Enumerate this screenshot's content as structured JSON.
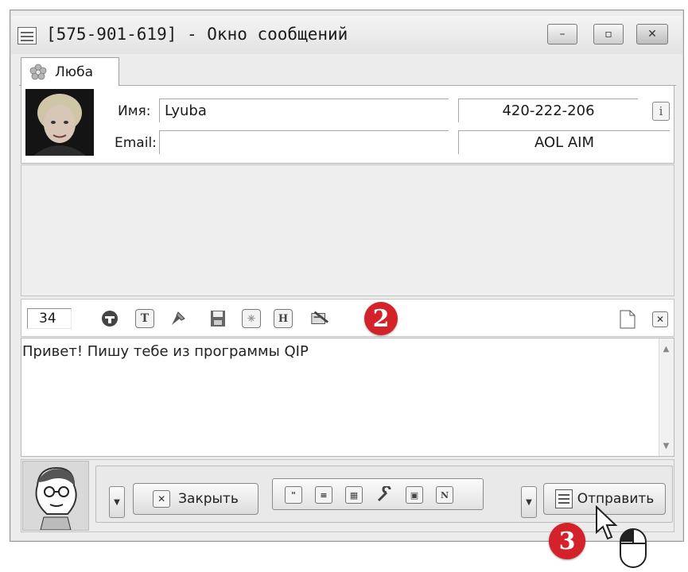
{
  "window": {
    "title": "[575-901-619] - Окно сообщений",
    "min_glyph": "–",
    "max_glyph": "▫",
    "close_glyph": "✕"
  },
  "tab": {
    "label": "Люба",
    "icon": "flower-status-icon"
  },
  "contact": {
    "name_label": "Имя:",
    "name_value": "Lyuba",
    "email_label": "Email:",
    "email_value": "",
    "uin": "420-222-206",
    "protocol": "AOL AIM",
    "info_icon": "info-icon"
  },
  "toolbar": {
    "char_count": "34",
    "icons": [
      "smiley-icon",
      "font-icon",
      "color-icon",
      "save-icon",
      "insert-icon",
      "history-icon",
      "clear-icon"
    ],
    "marker_2": "2"
  },
  "message": {
    "text": "Привет! Пишу тебе из программы QIP"
  },
  "bottom": {
    "close_label": "Закрыть",
    "send_label": "Отправить",
    "marker_3": "3",
    "group_icons": [
      "quote-icon",
      "list-icon",
      "table-icon",
      "tools-icon",
      "file-icon",
      "notes-icon"
    ]
  },
  "colors": {
    "marker": "#d3222a",
    "background": "#ececec"
  }
}
